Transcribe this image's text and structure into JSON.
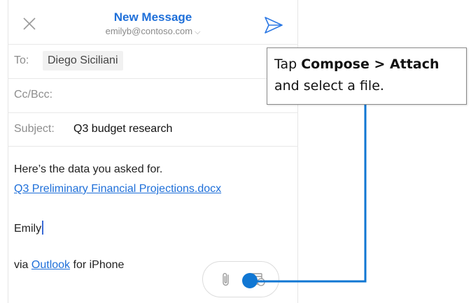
{
  "header": {
    "title": "New Message",
    "account": "emilyb@contoso.com",
    "account_chevron": "⌵"
  },
  "fields": {
    "to_label": "To:",
    "to_recipient": "Diego Siciliani",
    "cc_label": "Cc/Bcc:",
    "subject_label": "Subject:",
    "subject_value": "Q3 budget research"
  },
  "body": {
    "line1": "Here’s the data you asked for.",
    "attachment_link": "Q3 Preliminary Financial Projections.docx",
    "signature": "Emily",
    "footer_prefix": "via ",
    "footer_link": "Outlook",
    "footer_suffix": " for iPhone"
  },
  "callout": {
    "prefix": "Tap ",
    "bold": "Compose > Attach",
    "suffix": "and select a file."
  },
  "icons": {
    "close": "close-icon",
    "send": "send-icon",
    "attach": "paperclip-icon",
    "calendar": "calendar-icon"
  },
  "colors": {
    "accent": "#1e6fd9",
    "callout_line": "#1177d3"
  }
}
